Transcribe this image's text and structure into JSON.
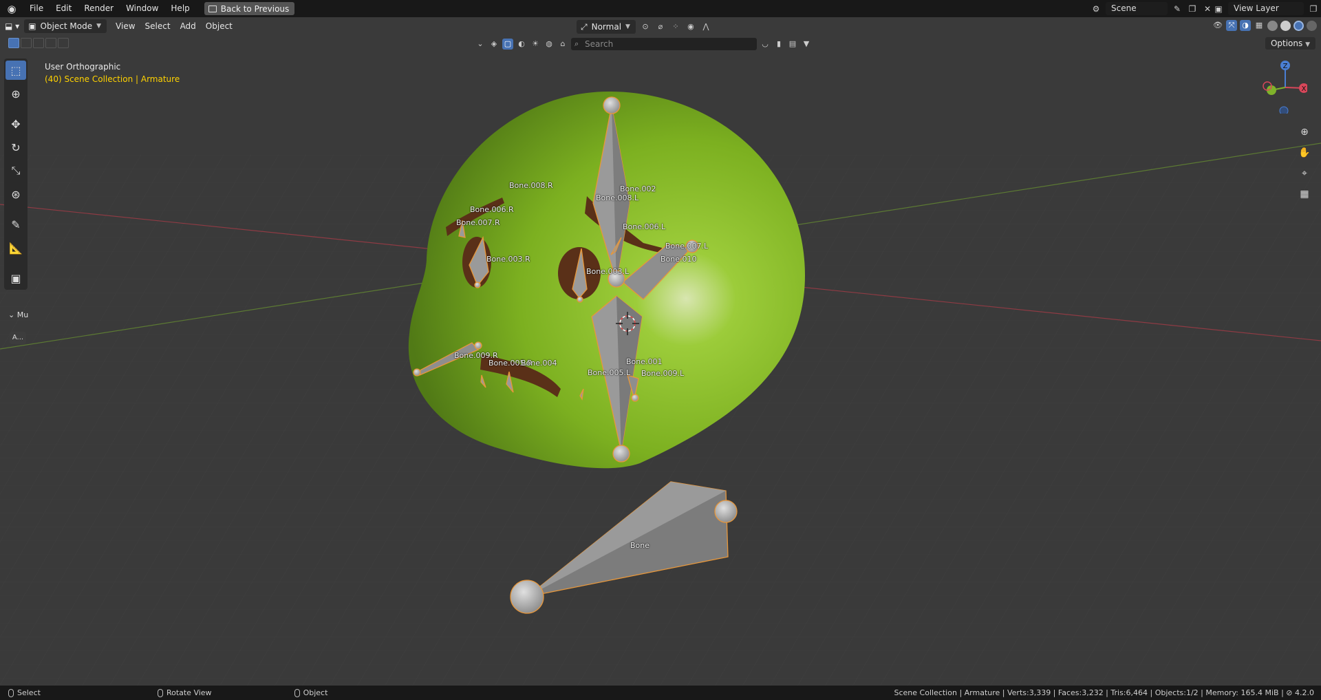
{
  "topbar": {
    "menus": [
      "File",
      "Edit",
      "Render",
      "Window",
      "Help"
    ],
    "back_button": "Back to Previous",
    "scene_name": "Scene",
    "view_layer": "View Layer"
  },
  "viewport_header": {
    "mode": "Object Mode",
    "menus": [
      "View",
      "Select",
      "Add",
      "Object"
    ],
    "transform_orientation": "Normal",
    "search_placeholder": "Search",
    "options_label": "Options"
  },
  "overlay": {
    "view_name": "User Orthographic",
    "collection_info": "(40) Scene Collection | Armature"
  },
  "side_panel": {
    "label": "Mu",
    "button": "A..."
  },
  "gizmo": {
    "z": "Z",
    "x": "X"
  },
  "bones": {
    "b008r": "Bone.008.R",
    "b002": "Bone.002",
    "b008l": "Bone.008.L",
    "b006r": "Bone.006.R",
    "b007r": "Bone.007.R",
    "b006l": "Bone.006.L",
    "b007l": "Bone.007.L",
    "b003r": "Bone.003.R",
    "b010": "Bone.010",
    "b003l": "Bone.003.L",
    "b009r": "Bone.009.R",
    "b005r": "Bone.005.R",
    "b004": "Bone.004",
    "b001": "Bone.001",
    "b005l": "Bone.005.L",
    "b009l": "Bone.009.L",
    "bone": "Bone"
  },
  "statusbar": {
    "select": "Select",
    "rotate": "Rotate View",
    "object": "Object",
    "stats": "Scene Collection | Armature | Verts:3,339 | Faces:3,232 | Tris:6,464 | Objects:1/2 | Memory: 165.4 MiB |",
    "version": "4.2.0"
  },
  "colors": {
    "accent": "#4772b3",
    "selection_outline": "#e8973a",
    "mesh_green": "#7fb22a",
    "active_text": "#ffd200"
  }
}
